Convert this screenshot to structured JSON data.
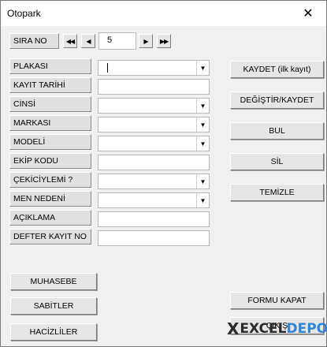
{
  "window": {
    "title": "Otopark",
    "close_glyph": "✕"
  },
  "navigation": {
    "label": "SIRA NO",
    "value": "5",
    "first_glyph": "◀◀",
    "prev_glyph": "◀",
    "next_glyph": "▶",
    "last_glyph": "▶▶"
  },
  "form": {
    "fields": [
      {
        "label": "PLAKASI",
        "type": "combobox",
        "value": ""
      },
      {
        "label": "KAYIT TARİHİ",
        "type": "text",
        "value": ""
      },
      {
        "label": "CİNSİ",
        "type": "combobox",
        "value": ""
      },
      {
        "label": "MARKASI",
        "type": "combobox",
        "value": ""
      },
      {
        "label": "MODELİ",
        "type": "combobox",
        "value": ""
      },
      {
        "label": "EKİP KODU",
        "type": "text",
        "value": ""
      },
      {
        "label": "ÇEKİCİYLEMİ ?",
        "type": "combobox",
        "value": ""
      },
      {
        "label": "MEN NEDENİ",
        "type": "combobox",
        "value": ""
      },
      {
        "label": "AÇIKLAMA",
        "type": "text",
        "value": ""
      },
      {
        "label": "DEFTER KAYIT NO",
        "type": "text",
        "value": ""
      }
    ],
    "dropdown_glyph": "▼"
  },
  "actions": {
    "save": "KAYDET (ilk kayıt)",
    "update": "DEĞİŞTİR/KAYDET",
    "find": "BUL",
    "delete": "SİL",
    "clear": "TEMİZLE",
    "close_form": "FORMU KAPAT",
    "exit": "ÇIKIŞ"
  },
  "sheets": {
    "accounting": "MUHASEBE",
    "constants": "SABİTLER",
    "seized": "HACİZLİLER"
  },
  "logo": {
    "prefix": "X",
    "part1": "EXCEL",
    "part2": "DEPO"
  },
  "colors": {
    "logo_blue": "#2f86d6",
    "logo_dark": "#2a2a2a"
  }
}
